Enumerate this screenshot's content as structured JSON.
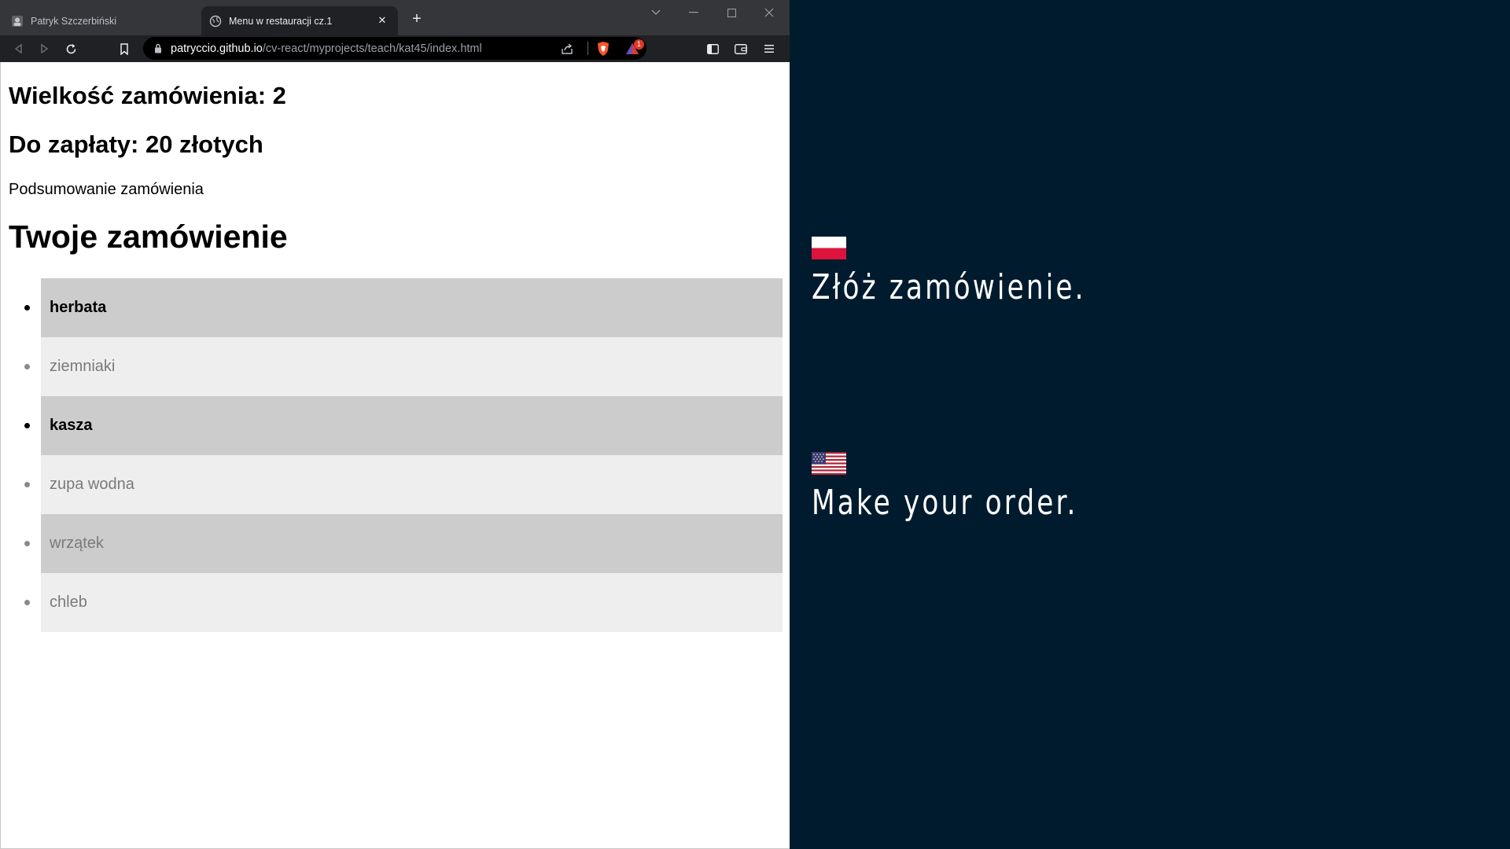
{
  "browser": {
    "tabs": [
      {
        "title": "Patryk Szczerbiński",
        "active": false
      },
      {
        "title": "Menu w restauracji cz.1",
        "active": true
      }
    ],
    "url": {
      "host": "patryccio.github.io",
      "path": "/cv-react/myprojects/teach/kat45/index.html"
    },
    "rewards_badge": "1",
    "colors": {
      "tabbar": "#35363a",
      "toolbar": "#202124",
      "omnibox": "#000000"
    }
  },
  "page": {
    "order_size": "Wielkość zamówienia: 2",
    "to_pay": "Do zapłaty: 20 złotych",
    "summary_label": "Podsumowanie zamówienia",
    "order_title": "Twoje zamówienie",
    "items": [
      {
        "label": "herbata",
        "selected": true,
        "shade": "dark"
      },
      {
        "label": "ziemniaki",
        "selected": false,
        "shade": "light"
      },
      {
        "label": "kasza",
        "selected": true,
        "shade": "dark"
      },
      {
        "label": "zupa wodna",
        "selected": false,
        "shade": "light"
      },
      {
        "label": "wrzątek",
        "selected": false,
        "shade": "dark"
      },
      {
        "label": "chleb",
        "selected": false,
        "shade": "light"
      }
    ],
    "colors": {
      "row_dark": "#cccccc",
      "row_light": "#eeeeee",
      "unselected_text": "#7a7a7a"
    }
  },
  "panel": {
    "caption_pl": "Złóż zamówienie.",
    "caption_en": "Make your order.",
    "flags": [
      "poland-flag-icon",
      "usa-flag-icon"
    ],
    "background": "#011b2e"
  }
}
